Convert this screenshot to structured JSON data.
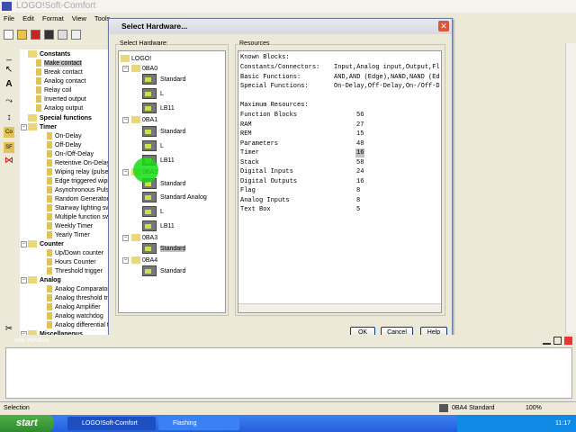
{
  "app": {
    "title": "LOGO!Soft-Comfort",
    "menu": [
      "File",
      "Edit",
      "Format",
      "View",
      "Tools"
    ]
  },
  "tree": {
    "items": [
      {
        "label": "Constants",
        "level": 0,
        "header": true
      },
      {
        "label": "Make contact",
        "level": 1,
        "selected": true
      },
      {
        "label": "Break contact",
        "level": 1
      },
      {
        "label": "Analog contact",
        "level": 1
      },
      {
        "label": "Relay coil",
        "level": 1
      },
      {
        "label": "Inverted output",
        "level": 1
      },
      {
        "label": "Analog output",
        "level": 1
      },
      {
        "label": "Special functions",
        "level": 0,
        "header": true
      },
      {
        "label": "Timer",
        "level": 1,
        "header": true
      },
      {
        "label": "On-Delay",
        "level": 2
      },
      {
        "label": "Off-Delay",
        "level": 2
      },
      {
        "label": "On-/Off-Delay",
        "level": 2
      },
      {
        "label": "Retentive On-Delay",
        "level": 2
      },
      {
        "label": "Wiping relay (pulse o",
        "level": 2
      },
      {
        "label": "Edge triggered wiping",
        "level": 2
      },
      {
        "label": "Asynchronous Pulse",
        "level": 2
      },
      {
        "label": "Random Generator",
        "level": 2
      },
      {
        "label": "Stairway lighting swit",
        "level": 2
      },
      {
        "label": "Multiple function swit",
        "level": 2
      },
      {
        "label": "Weekly Timer",
        "level": 2
      },
      {
        "label": "Yearly Timer",
        "level": 2
      },
      {
        "label": "Counter",
        "level": 1,
        "header": true
      },
      {
        "label": "Up/Down counter",
        "level": 2
      },
      {
        "label": "Hours Counter",
        "level": 2
      },
      {
        "label": "Threshold trigger",
        "level": 2
      },
      {
        "label": "Analog",
        "level": 1,
        "header": true
      },
      {
        "label": "Analog Comparator",
        "level": 2
      },
      {
        "label": "Analog threshold trig",
        "level": 2
      },
      {
        "label": "Analog Amplifier",
        "level": 2
      },
      {
        "label": "Analog watchdog",
        "level": 2
      },
      {
        "label": "Analog differential trig",
        "level": 2
      },
      {
        "label": "Miscellaneous",
        "level": 1,
        "header": true
      }
    ]
  },
  "dialog": {
    "title": "Select Hardware...",
    "hw_label": "Select Hardware:",
    "res_label": "Resources",
    "hardware": [
      {
        "label": "LOGO!",
        "type": "root"
      },
      {
        "label": "0BA0",
        "type": "folder"
      },
      {
        "label": "Standard",
        "type": "module"
      },
      {
        "label": "L",
        "type": "module"
      },
      {
        "label": "LB11",
        "type": "module"
      },
      {
        "label": "0BA1",
        "type": "folder"
      },
      {
        "label": "Standard",
        "type": "module"
      },
      {
        "label": "L",
        "type": "module"
      },
      {
        "label": "LB11",
        "type": "module"
      },
      {
        "label": "0BA2",
        "type": "folder"
      },
      {
        "label": "Standard",
        "type": "module"
      },
      {
        "label": "Standard Analog",
        "type": "module"
      },
      {
        "label": "L",
        "type": "module"
      },
      {
        "label": "LB11",
        "type": "module"
      },
      {
        "label": "0BA3",
        "type": "folder"
      },
      {
        "label": "Standard",
        "type": "module",
        "selected": true
      },
      {
        "label": "0BA4",
        "type": "folder"
      },
      {
        "label": "Standard",
        "type": "module"
      }
    ],
    "known_blocks_label": "Known Blocks:",
    "known": [
      {
        "k": "Constants/Connectors:",
        "v": "Input,Analog input,Output,Fl"
      },
      {
        "k": "Basic Functions:",
        "v": "AND,AND (Edge),NAND,NAND (Ed"
      },
      {
        "k": "Special Functions:",
        "v": "On-Delay,Off-Delay,On-/Off-D"
      }
    ],
    "max_label": "Maximum Resources:",
    "resources": [
      {
        "k": "Function Blocks",
        "v": "56"
      },
      {
        "k": "RAM",
        "v": "27"
      },
      {
        "k": "REM",
        "v": "15"
      },
      {
        "k": "Parameters",
        "v": "48"
      },
      {
        "k": "Timer",
        "v": "16",
        "selected": true
      },
      {
        "k": "Stack",
        "v": "58"
      },
      {
        "k": "Digital Inputs",
        "v": "24"
      },
      {
        "k": "Digital Outputs",
        "v": "16"
      },
      {
        "k": "Flag",
        "v": "8"
      },
      {
        "k": "Analog Inputs",
        "v": "8"
      },
      {
        "k": "Text Box",
        "v": "5"
      }
    ],
    "ok": "OK",
    "cancel": "Cancel",
    "help": "Help"
  },
  "info": {
    "title": "Info Window"
  },
  "status": {
    "text": "Selection",
    "hardware": "0BA4 Standard",
    "zoom": "100%"
  },
  "taskbar": {
    "start": "start",
    "tasks": [
      "LOGO!Soft-Comfort",
      "Flashing"
    ],
    "clock": "11:17"
  }
}
